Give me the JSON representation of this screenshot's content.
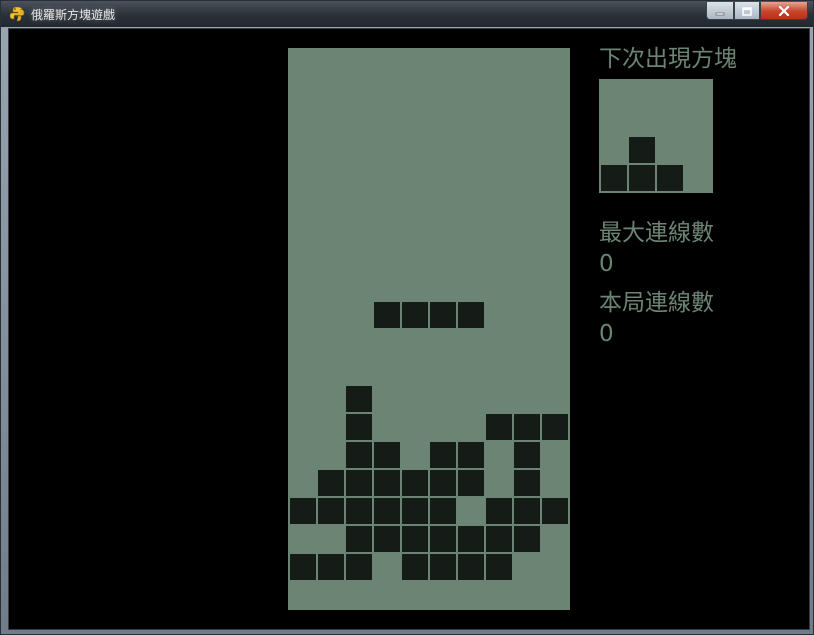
{
  "window": {
    "title": "俄羅斯方塊遊戲",
    "app_icon": "python-snake-icon",
    "controls": [
      "minimize-icon",
      "maximize-icon",
      "close-icon"
    ]
  },
  "colors": {
    "board": "#6c8474",
    "block": "#151c17",
    "background": "#000000",
    "text": "#6c8474"
  },
  "game": {
    "board_columns": 10,
    "board_rows": 20,
    "locked_blocks": [
      [
        12,
        2
      ],
      [
        13,
        2
      ],
      [
        13,
        7
      ],
      [
        13,
        8
      ],
      [
        13,
        9
      ],
      [
        14,
        2
      ],
      [
        14,
        3
      ],
      [
        14,
        5
      ],
      [
        14,
        6
      ],
      [
        14,
        8
      ],
      [
        15,
        1
      ],
      [
        15,
        2
      ],
      [
        15,
        3
      ],
      [
        15,
        4
      ],
      [
        15,
        5
      ],
      [
        15,
        6
      ],
      [
        15,
        8
      ],
      [
        16,
        0
      ],
      [
        16,
        1
      ],
      [
        16,
        2
      ],
      [
        16,
        3
      ],
      [
        16,
        4
      ],
      [
        16,
        5
      ],
      [
        16,
        7
      ],
      [
        16,
        8
      ],
      [
        16,
        9
      ],
      [
        17,
        2
      ],
      [
        17,
        3
      ],
      [
        17,
        4
      ],
      [
        17,
        5
      ],
      [
        17,
        6
      ],
      [
        17,
        7
      ],
      [
        17,
        8
      ],
      [
        18,
        0
      ],
      [
        18,
        1
      ],
      [
        18,
        2
      ],
      [
        18,
        4
      ],
      [
        18,
        5
      ],
      [
        18,
        6
      ],
      [
        18,
        7
      ]
    ],
    "falling_piece": {
      "shape": "I",
      "blocks": [
        [
          9,
          3
        ],
        [
          9,
          4
        ],
        [
          9,
          5
        ],
        [
          9,
          6
        ]
      ]
    }
  },
  "sidebar": {
    "next_label": "下次出現方塊",
    "next_piece": {
      "shape": "T",
      "blocks": [
        [
          2,
          1
        ],
        [
          3,
          0
        ],
        [
          3,
          1
        ],
        [
          3,
          2
        ]
      ]
    },
    "max_lines_label": "最大連線數",
    "max_lines_value": "0",
    "current_lines_label": "本局連線數",
    "current_lines_value": "0"
  }
}
